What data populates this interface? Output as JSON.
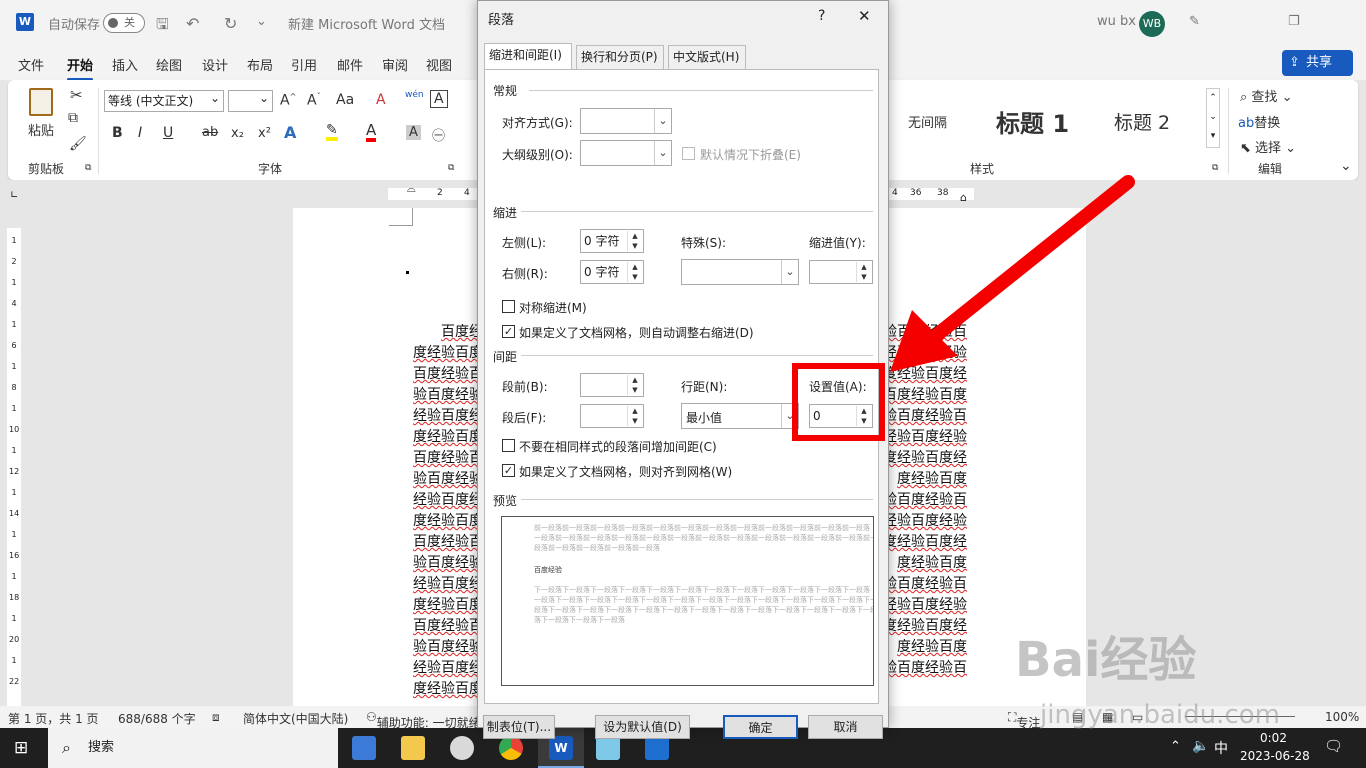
{
  "app": {
    "autosave_label": "自动保存",
    "autosave_state": "关",
    "doc_title": "新建 Microsoft Word 文档",
    "user_name": "wu bx",
    "user_initials": "WB",
    "share_label": "共享"
  },
  "tabs": [
    "文件",
    "开始",
    "插入",
    "绘图",
    "设计",
    "布局",
    "引用",
    "邮件",
    "审阅",
    "视图"
  ],
  "ribbon": {
    "paste": "粘贴",
    "clipboard": "剪贴板",
    "font_name": "等线 (中文正文)",
    "font_size": "",
    "font_group": "字体",
    "styles_group": "样式",
    "style_nospacing": "无间隔",
    "style_h1": "标题 1",
    "style_h2": "标题 2",
    "find": "查找",
    "replace": "替换",
    "select": "选择",
    "edit_group": "编辑",
    "bold": "B",
    "italic": "I",
    "underline": "U",
    "strike": "ab",
    "subscript": "x₂",
    "superscript": "x²",
    "font_grow": "A^",
    "font_shrink": "Aˇ",
    "change_case": "Aa",
    "font_color_A": "A",
    "char_border": "A",
    "phonetic": "wén",
    "pinyin_char": "A"
  },
  "ruler": {
    "left_nums": [
      "2",
      "4"
    ],
    "right_nums": [
      "4",
      "36",
      "38"
    ],
    "vert_nums": [
      "1",
      "2",
      "1",
      "4",
      "1",
      "6",
      "1",
      "8",
      "1",
      "10",
      "1",
      "12",
      "1",
      "14",
      "1",
      "16",
      "1",
      "18",
      "1",
      "20",
      "1",
      "22"
    ]
  },
  "document": {
    "left_lines": [
      "百度经",
      "度经验百度",
      "百度经验百",
      "验百度经验",
      "经验百度经",
      "度经验百度",
      "百度经验百",
      "验百度经验",
      "经验百度经",
      "度经验百度",
      "百度经验百",
      "验百度经验",
      "经验百度经",
      "度经验百度",
      "百度经验百",
      "验百度经验",
      "经验百度经",
      "度经验百度"
    ],
    "right_lines": [
      "验百度经验百",
      "度经验百度经验",
      "验百度经验百度经",
      "百度经验百度",
      "验百度经验百",
      "验百度经验百度经验",
      "度经验百度经",
      "度经验百度",
      "度经验百度经验百",
      "验百度经验百度经验",
      "百度经验百度经",
      "度经验百度",
      "度经验百度经验百",
      "验百度经验百度经验",
      "百度经验百度经",
      "度经验百度",
      "度经验百度经验百"
    ]
  },
  "status": {
    "page": "第 1 页，共 1 页",
    "words": "688/688 个字",
    "lang": "简体中文(中国大陆)",
    "accessibility": "辅助功能: 一切就绪",
    "focus": "专注",
    "zoom": "100%"
  },
  "taskbar": {
    "search": "搜索",
    "ime": "中",
    "time": "0:02",
    "date": "2023-06-28"
  },
  "dialog": {
    "title": "段落",
    "help": "?",
    "close": "✕",
    "tabs": [
      "缩进和间距(I)",
      "换行和分页(P)",
      "中文版式(H)"
    ],
    "general_section": "常规",
    "alignment_label": "对齐方式(G):",
    "alignment_value": "",
    "outline_label": "大纲级别(O):",
    "outline_value": "",
    "collapse_label": "默认情况下折叠(E)",
    "indent_section": "缩进",
    "left_label": "左侧(L):",
    "left_value": "0 字符",
    "right_label": "右侧(R):",
    "right_value": "0 字符",
    "special_label": "特殊(S):",
    "special_value": "",
    "indent_by_label": "缩进值(Y):",
    "indent_by_value": "",
    "mirror_label": "对称缩进(M)",
    "mirror_checked": false,
    "auto_right_label": "如果定义了文档网格，则自动调整右缩进(D)",
    "auto_right_checked": true,
    "spacing_section": "间距",
    "before_label": "段前(B):",
    "before_value": "",
    "after_label": "段后(F):",
    "after_value": "",
    "line_spacing_label": "行距(N):",
    "line_spacing_value": "最小值",
    "at_label": "设置值(A):",
    "at_value": "0",
    "no_space_label": "不要在相同样式的段落间增加间距(C)",
    "no_space_checked": false,
    "snap_grid_label": "如果定义了文档网格，则对齐到网格(W)",
    "snap_grid_checked": true,
    "preview_section": "预览",
    "preview_prev": [
      "前一段落前一段落前一段落前一段落前一段落前一段落前一段落前一段落前一段落前一段落前一段落前一段落",
      "一段落前一段落前一段落前一段落前一段落前一段落前一段落前一段落前一段落前一段落前一段落前一段落前一",
      "段落前一段落前一段落前一段落前一段落"
    ],
    "preview_sample": "百度经验",
    "preview_next": [
      "下一段落下一段落下一段落下一段落下一段落下一段落下一段落下一段落下一段落下一段落下一段落下一段落",
      "一段落下一段落下一段落下一段落下一段落下一段落下一段落下一段落下一段落下一段落下一段落下一段落下一",
      "段落下一段落下一段落下一段落下一段落下一段落下一段落下一段落下一段落下一段落下一段落下一段落下一段落",
      "落下一段落下一段落下一段落"
    ],
    "btn_tabs": "制表位(T)...",
    "btn_default": "设为默认值(D)",
    "btn_ok": "确定",
    "btn_cancel": "取消"
  },
  "annotation_colors": {
    "highlight": "#f40000"
  },
  "watermark": {
    "text": "Bai经验",
    "url": "jingyan.baidu.com"
  }
}
